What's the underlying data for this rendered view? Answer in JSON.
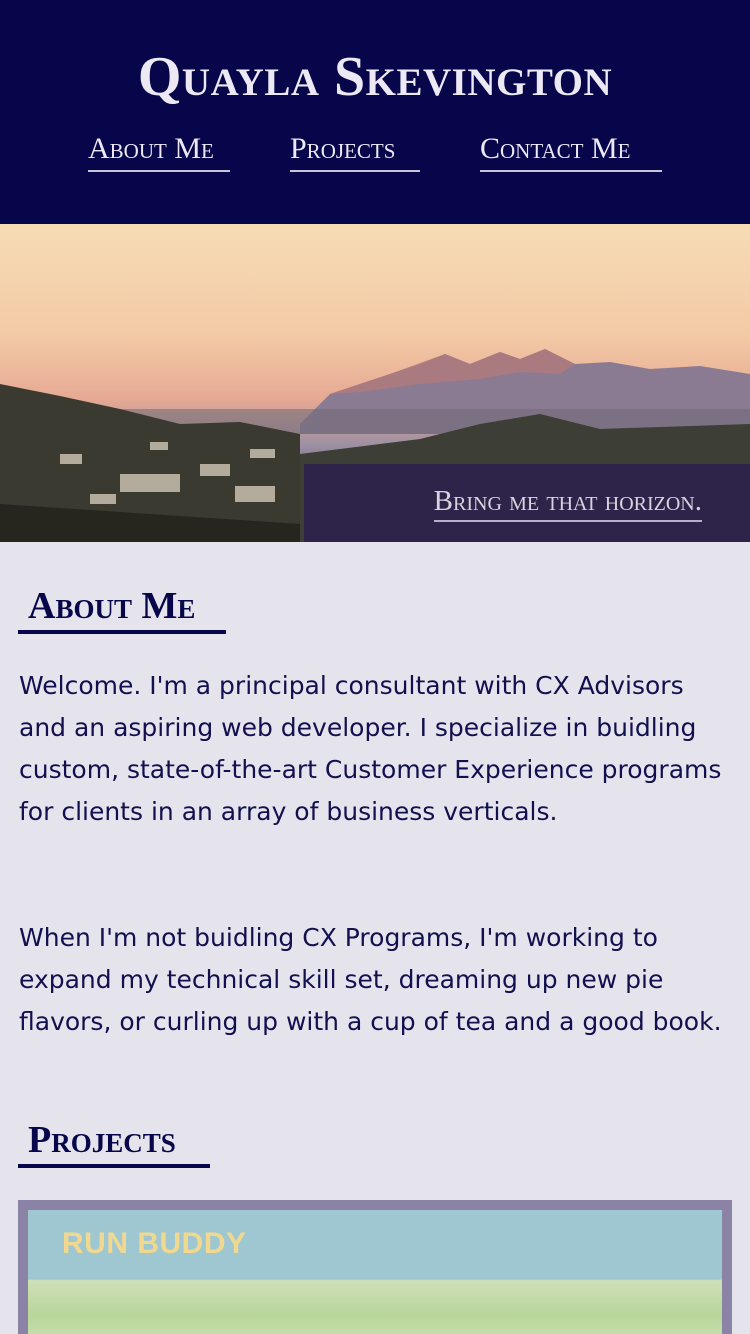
{
  "header": {
    "title": "Quayla Skevington",
    "nav": [
      {
        "label": "About Me"
      },
      {
        "label": "Projects"
      },
      {
        "label": "Contact Me"
      }
    ]
  },
  "hero": {
    "tagline": "Bring me that horizon."
  },
  "about": {
    "heading": "About Me",
    "paragraphs": [
      "Welcome. I'm a principal consultant with CX Advisors and an aspiring web developer. I specialize in buidling custom, state-of-the-art Customer Experience programs for clients in an array of business verticals.",
      "When I'm not buidling CX Programs, I'm working to expand my technical skill set, dreaming up new pie flavors, or curling up with a cup of tea and a good book."
    ]
  },
  "projects": {
    "heading": "Projects",
    "items": [
      {
        "name": "RUN BUDDY"
      }
    ]
  },
  "colors": {
    "header_bg": "#07064a",
    "page_bg": "#e5e4ec",
    "text": "#0d0a4d",
    "accent_light": "#ece9f4"
  }
}
